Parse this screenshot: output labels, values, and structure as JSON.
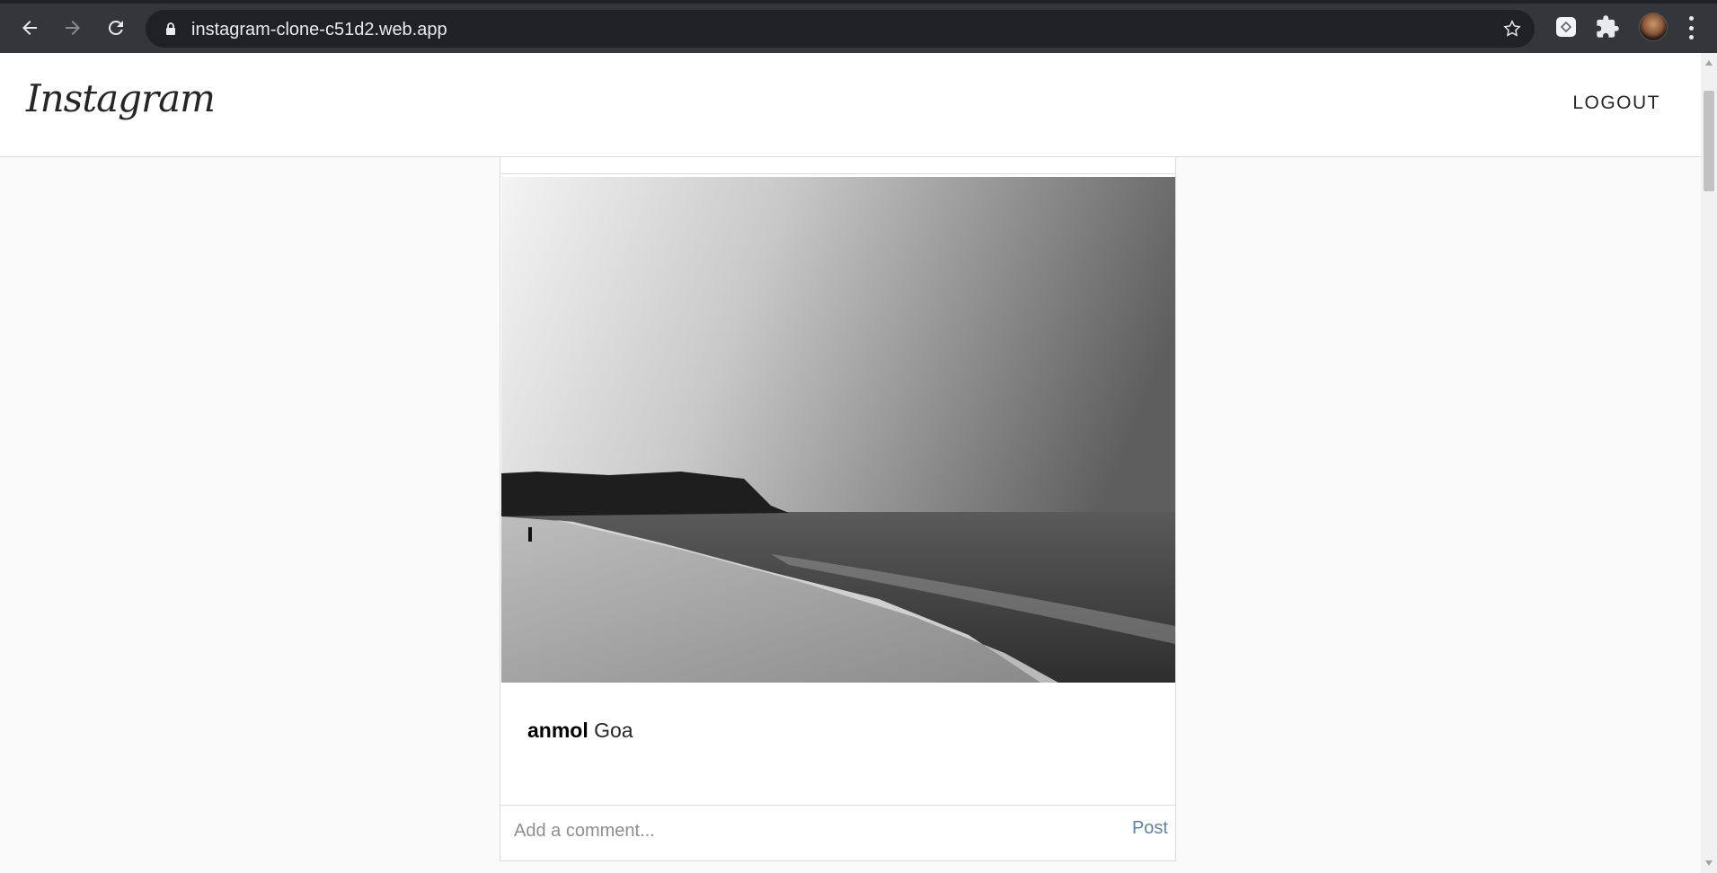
{
  "browser": {
    "url": "instagram-clone-c51d2.web.app",
    "icons": [
      "back-arrow-icon",
      "forward-arrow-icon",
      "reload-icon",
      "lock-icon",
      "star-icon",
      "extension-icon",
      "puzzle-icon",
      "menu-icon"
    ]
  },
  "header": {
    "logo_text": "Instagram",
    "logout_label": "LOGOUT"
  },
  "post": {
    "username": "anmol",
    "caption": "Goa",
    "comment_placeholder": "Add a comment...",
    "post_label": "Post"
  },
  "colors": {
    "post_button": "#6082a3",
    "border": "#dbdbdb",
    "page_bg": "#fafafa"
  }
}
